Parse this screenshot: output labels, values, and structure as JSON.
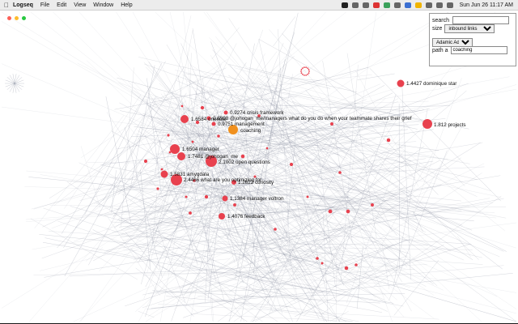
{
  "menubar": {
    "app_name": "Logseq",
    "menus": [
      "File",
      "Edit",
      "View",
      "Window",
      "Help"
    ],
    "clock": "Sun Jun 26  11:17 AM"
  },
  "controls": {
    "search_label": "search",
    "search_value": "",
    "size_label": "size",
    "size_value": "inbound links",
    "algorithm_value": "Adamic Adar",
    "path_label": "path a",
    "path_value": "coaching"
  },
  "colors": {
    "node": "#e8414e",
    "selected_node": "#f0901e",
    "edge": "#8a8fa0"
  },
  "graph": {
    "labeled_nodes": [
      {
        "id": "crisis",
        "label": "0.9274 crisis framework"
      },
      {
        "id": "grief",
        "label": "0.8598 @johogan_me/managers what do you do when your teammate shares their grief"
      },
      {
        "id": "onenote",
        "label": "1.6584 onenote"
      },
      {
        "id": "management",
        "label": "0.9751 management"
      },
      {
        "id": "coaching",
        "label": "coaching",
        "selected": true
      },
      {
        "id": "manager",
        "label": "1.6504 manager"
      },
      {
        "id": "johogan",
        "label": "1.7481 @johogan_me"
      },
      {
        "id": "openq",
        "label": "2.1002 open questions"
      },
      {
        "id": "amygdala",
        "label": "1.5831 amygdala"
      },
      {
        "id": "optimizing",
        "label": "2.4466 what are you optimizing for"
      },
      {
        "id": "curiosity",
        "label": "1.2622 curiosity"
      },
      {
        "id": "voltron",
        "label": "1.1384 manager voltron"
      },
      {
        "id": "feedback",
        "label": "1.4076 feedback"
      },
      {
        "id": "dstar",
        "label": "1.4427 dominique star"
      },
      {
        "id": "projects",
        "label": "1.812 projects"
      }
    ]
  }
}
